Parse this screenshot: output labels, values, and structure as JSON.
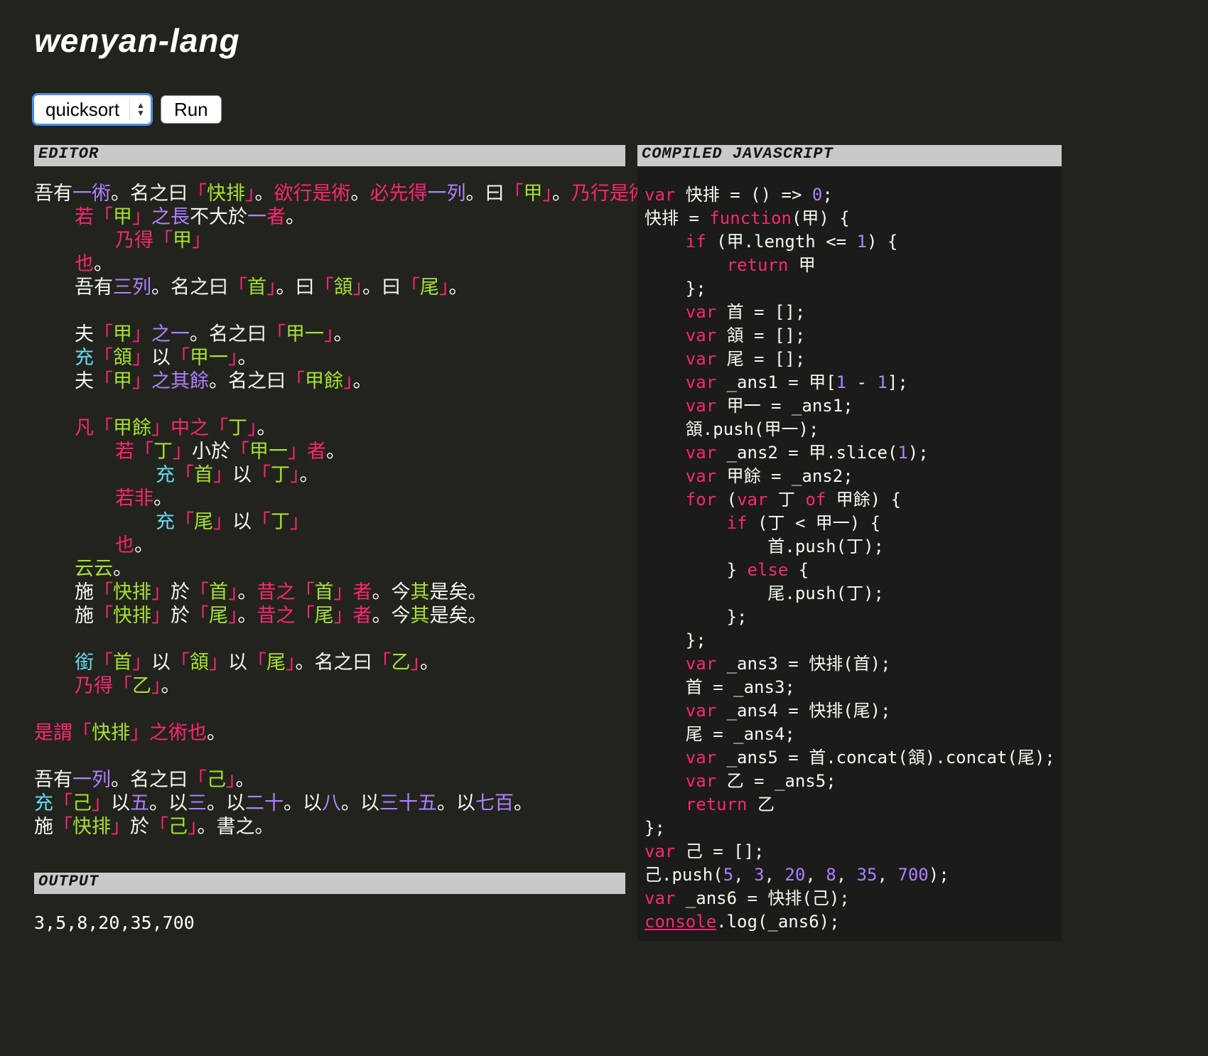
{
  "page": {
    "title": "wenyan-lang"
  },
  "toolbar": {
    "example_selected": "quicksort",
    "run_label": "Run"
  },
  "panels": {
    "editor_title": "EDITOR",
    "js_title": "COMPILED JAVASCRIPT",
    "output_title": "OUTPUT"
  },
  "output": {
    "text": "3,5,8,20,35,700"
  },
  "colors": {
    "page_bg": "#23231e",
    "js_panel_bg": "#1b1b19",
    "panel_header_bg": "#c9c9c9",
    "focus_ring": "#4a8fe2",
    "white": "#f8f8f2",
    "pink": "#f92672",
    "green": "#a6e22e",
    "purple": "#ae81ff",
    "cyan": "#66d9ef"
  },
  "editor_lines": [
    {
      "indent": 0,
      "tokens": [
        [
          "w",
          "吾有"
        ],
        [
          "b",
          "一術"
        ],
        [
          "w",
          "。"
        ],
        [
          "w",
          "名之曰"
        ],
        [
          "p",
          "「"
        ],
        [
          "g",
          "快排"
        ],
        [
          "p",
          "」"
        ],
        [
          "w",
          "。"
        ],
        [
          "p",
          "欲行是術"
        ],
        [
          "w",
          "。"
        ],
        [
          "p",
          "必先得"
        ],
        [
          "b",
          "一列"
        ],
        [
          "w",
          "。曰"
        ],
        [
          "p",
          "「"
        ],
        [
          "g",
          "甲"
        ],
        [
          "p",
          "」"
        ],
        [
          "w",
          "。"
        ],
        [
          "p",
          "乃行是術曰"
        ],
        [
          "w",
          "。"
        ]
      ]
    },
    {
      "indent": 1,
      "tokens": [
        [
          "p",
          "若"
        ],
        [
          "p",
          "「"
        ],
        [
          "g",
          "甲"
        ],
        [
          "p",
          "」"
        ],
        [
          "b",
          "之長"
        ],
        [
          "w",
          "不大於"
        ],
        [
          "b",
          "一"
        ],
        [
          "p",
          "者"
        ],
        [
          "w",
          "。"
        ]
      ]
    },
    {
      "indent": 2,
      "tokens": [
        [
          "p",
          "乃得"
        ],
        [
          "p",
          "「"
        ],
        [
          "g",
          "甲"
        ],
        [
          "p",
          "」"
        ]
      ]
    },
    {
      "indent": 1,
      "tokens": [
        [
          "p",
          "也"
        ],
        [
          "w",
          "。"
        ]
      ]
    },
    {
      "indent": 1,
      "tokens": [
        [
          "w",
          "吾有"
        ],
        [
          "b",
          "三列"
        ],
        [
          "w",
          "。名之曰"
        ],
        [
          "p",
          "「"
        ],
        [
          "g",
          "首"
        ],
        [
          "p",
          "」"
        ],
        [
          "w",
          "。曰"
        ],
        [
          "p",
          "「"
        ],
        [
          "g",
          "頷"
        ],
        [
          "p",
          "」"
        ],
        [
          "w",
          "。曰"
        ],
        [
          "p",
          "「"
        ],
        [
          "g",
          "尾"
        ],
        [
          "p",
          "」"
        ],
        [
          "w",
          "。"
        ]
      ]
    },
    {
      "indent": 0,
      "tokens": []
    },
    {
      "indent": 1,
      "tokens": [
        [
          "w",
          "夫"
        ],
        [
          "p",
          "「"
        ],
        [
          "g",
          "甲"
        ],
        [
          "p",
          "」"
        ],
        [
          "b",
          "之一"
        ],
        [
          "w",
          "。名之曰"
        ],
        [
          "p",
          "「"
        ],
        [
          "g",
          "甲一"
        ],
        [
          "p",
          "」"
        ],
        [
          "w",
          "。"
        ]
      ]
    },
    {
      "indent": 1,
      "tokens": [
        [
          "c",
          "充"
        ],
        [
          "p",
          "「"
        ],
        [
          "g",
          "頷"
        ],
        [
          "p",
          "」"
        ],
        [
          "w",
          "以"
        ],
        [
          "p",
          "「"
        ],
        [
          "g",
          "甲一"
        ],
        [
          "p",
          "」"
        ],
        [
          "w",
          "。"
        ]
      ]
    },
    {
      "indent": 1,
      "tokens": [
        [
          "w",
          "夫"
        ],
        [
          "p",
          "「"
        ],
        [
          "g",
          "甲"
        ],
        [
          "p",
          "」"
        ],
        [
          "b",
          "之其餘"
        ],
        [
          "w",
          "。名之曰"
        ],
        [
          "p",
          "「"
        ],
        [
          "g",
          "甲餘"
        ],
        [
          "p",
          "」"
        ],
        [
          "w",
          "。"
        ]
      ]
    },
    {
      "indent": 0,
      "tokens": []
    },
    {
      "indent": 1,
      "tokens": [
        [
          "p",
          "凡"
        ],
        [
          "p",
          "「"
        ],
        [
          "g",
          "甲餘"
        ],
        [
          "p",
          "」"
        ],
        [
          "p",
          "中之"
        ],
        [
          "p",
          "「"
        ],
        [
          "g",
          "丁"
        ],
        [
          "p",
          "」"
        ],
        [
          "w",
          "。"
        ]
      ]
    },
    {
      "indent": 2,
      "tokens": [
        [
          "p",
          "若"
        ],
        [
          "p",
          "「"
        ],
        [
          "g",
          "丁"
        ],
        [
          "p",
          "」"
        ],
        [
          "w",
          "小於"
        ],
        [
          "p",
          "「"
        ],
        [
          "g",
          "甲一"
        ],
        [
          "p",
          "」"
        ],
        [
          "p",
          "者"
        ],
        [
          "w",
          "。"
        ]
      ]
    },
    {
      "indent": 3,
      "tokens": [
        [
          "c",
          "充"
        ],
        [
          "p",
          "「"
        ],
        [
          "g",
          "首"
        ],
        [
          "p",
          "」"
        ],
        [
          "w",
          "以"
        ],
        [
          "p",
          "「"
        ],
        [
          "g",
          "丁"
        ],
        [
          "p",
          "」"
        ],
        [
          "w",
          "。"
        ]
      ]
    },
    {
      "indent": 2,
      "tokens": [
        [
          "p",
          "若非"
        ],
        [
          "w",
          "。"
        ]
      ]
    },
    {
      "indent": 3,
      "tokens": [
        [
          "c",
          "充"
        ],
        [
          "p",
          "「"
        ],
        [
          "g",
          "尾"
        ],
        [
          "p",
          "」"
        ],
        [
          "w",
          "以"
        ],
        [
          "p",
          "「"
        ],
        [
          "g",
          "丁"
        ],
        [
          "p",
          "」"
        ]
      ]
    },
    {
      "indent": 2,
      "tokens": [
        [
          "p",
          "也"
        ],
        [
          "w",
          "。"
        ]
      ]
    },
    {
      "indent": 1,
      "tokens": [
        [
          "g",
          "云云"
        ],
        [
          "w",
          "。"
        ]
      ]
    },
    {
      "indent": 1,
      "tokens": [
        [
          "w",
          "施"
        ],
        [
          "p",
          "「"
        ],
        [
          "g",
          "快排"
        ],
        [
          "p",
          "」"
        ],
        [
          "w",
          "於"
        ],
        [
          "p",
          "「"
        ],
        [
          "g",
          "首"
        ],
        [
          "p",
          "」"
        ],
        [
          "w",
          "。"
        ],
        [
          "p",
          "昔之"
        ],
        [
          "p",
          "「"
        ],
        [
          "g",
          "首"
        ],
        [
          "p",
          "」"
        ],
        [
          "p",
          "者"
        ],
        [
          "w",
          "。今"
        ],
        [
          "g",
          "其"
        ],
        [
          "w",
          "是矣。"
        ]
      ]
    },
    {
      "indent": 1,
      "tokens": [
        [
          "w",
          "施"
        ],
        [
          "p",
          "「"
        ],
        [
          "g",
          "快排"
        ],
        [
          "p",
          "」"
        ],
        [
          "w",
          "於"
        ],
        [
          "p",
          "「"
        ],
        [
          "g",
          "尾"
        ],
        [
          "p",
          "」"
        ],
        [
          "w",
          "。"
        ],
        [
          "p",
          "昔之"
        ],
        [
          "p",
          "「"
        ],
        [
          "g",
          "尾"
        ],
        [
          "p",
          "」"
        ],
        [
          "p",
          "者"
        ],
        [
          "w",
          "。今"
        ],
        [
          "g",
          "其"
        ],
        [
          "w",
          "是矣。"
        ]
      ]
    },
    {
      "indent": 0,
      "tokens": []
    },
    {
      "indent": 1,
      "tokens": [
        [
          "c",
          "銜"
        ],
        [
          "p",
          "「"
        ],
        [
          "g",
          "首"
        ],
        [
          "p",
          "」"
        ],
        [
          "w",
          "以"
        ],
        [
          "p",
          "「"
        ],
        [
          "g",
          "頷"
        ],
        [
          "p",
          "」"
        ],
        [
          "w",
          "以"
        ],
        [
          "p",
          "「"
        ],
        [
          "g",
          "尾"
        ],
        [
          "p",
          "」"
        ],
        [
          "w",
          "。名之曰"
        ],
        [
          "p",
          "「"
        ],
        [
          "g",
          "乙"
        ],
        [
          "p",
          "」"
        ],
        [
          "w",
          "。"
        ]
      ]
    },
    {
      "indent": 1,
      "tokens": [
        [
          "p",
          "乃得"
        ],
        [
          "p",
          "「"
        ],
        [
          "g",
          "乙"
        ],
        [
          "p",
          "」"
        ],
        [
          "w",
          "。"
        ]
      ]
    },
    {
      "indent": 0,
      "tokens": []
    },
    {
      "indent": 0,
      "tokens": [
        [
          "p",
          "是謂"
        ],
        [
          "p",
          "「"
        ],
        [
          "g",
          "快排"
        ],
        [
          "p",
          "」"
        ],
        [
          "p",
          "之術也"
        ],
        [
          "w",
          "。"
        ]
      ]
    },
    {
      "indent": 0,
      "tokens": []
    },
    {
      "indent": 0,
      "tokens": [
        [
          "w",
          "吾有"
        ],
        [
          "b",
          "一列"
        ],
        [
          "w",
          "。名之曰"
        ],
        [
          "p",
          "「"
        ],
        [
          "g",
          "己"
        ],
        [
          "p",
          "」"
        ],
        [
          "w",
          "。"
        ]
      ]
    },
    {
      "indent": 0,
      "tokens": [
        [
          "c",
          "充"
        ],
        [
          "p",
          "「"
        ],
        [
          "g",
          "己"
        ],
        [
          "p",
          "」"
        ],
        [
          "w",
          "以"
        ],
        [
          "b",
          "五"
        ],
        [
          "w",
          "。以"
        ],
        [
          "b",
          "三"
        ],
        [
          "w",
          "。以"
        ],
        [
          "b",
          "二十"
        ],
        [
          "w",
          "。以"
        ],
        [
          "b",
          "八"
        ],
        [
          "w",
          "。以"
        ],
        [
          "b",
          "三十五"
        ],
        [
          "w",
          "。以"
        ],
        [
          "b",
          "七百"
        ],
        [
          "w",
          "。"
        ]
      ]
    },
    {
      "indent": 0,
      "tokens": [
        [
          "w",
          "施"
        ],
        [
          "p",
          "「"
        ],
        [
          "g",
          "快排"
        ],
        [
          "p",
          "」"
        ],
        [
          "w",
          "於"
        ],
        [
          "p",
          "「"
        ],
        [
          "g",
          "己"
        ],
        [
          "p",
          "」"
        ],
        [
          "w",
          "。書之。"
        ]
      ]
    }
  ],
  "js_lines": [
    [
      [
        "p",
        "var"
      ],
      [
        "w",
        " 快排 = () => "
      ],
      [
        "b",
        "0"
      ],
      [
        "w",
        ";"
      ]
    ],
    [
      [
        "w",
        "快排 = "
      ],
      [
        "p",
        "function"
      ],
      [
        "w",
        "(甲) {"
      ]
    ],
    [
      [
        "w",
        "    "
      ],
      [
        "p",
        "if"
      ],
      [
        "w",
        " (甲.length <= "
      ],
      [
        "b",
        "1"
      ],
      [
        "w",
        ") {"
      ]
    ],
    [
      [
        "w",
        "        "
      ],
      [
        "p",
        "return"
      ],
      [
        "w",
        " 甲"
      ]
    ],
    [
      [
        "w",
        "    };"
      ]
    ],
    [
      [
        "w",
        "    "
      ],
      [
        "p",
        "var"
      ],
      [
        "w",
        " 首 = [];"
      ]
    ],
    [
      [
        "w",
        "    "
      ],
      [
        "p",
        "var"
      ],
      [
        "w",
        " 頷 = [];"
      ]
    ],
    [
      [
        "w",
        "    "
      ],
      [
        "p",
        "var"
      ],
      [
        "w",
        " 尾 = [];"
      ]
    ],
    [
      [
        "w",
        "    "
      ],
      [
        "p",
        "var"
      ],
      [
        "w",
        " _ans1 = 甲["
      ],
      [
        "b",
        "1"
      ],
      [
        "w",
        " - "
      ],
      [
        "b",
        "1"
      ],
      [
        "w",
        "];"
      ]
    ],
    [
      [
        "w",
        "    "
      ],
      [
        "p",
        "var"
      ],
      [
        "w",
        " 甲一 = _ans1;"
      ]
    ],
    [
      [
        "w",
        "    頷.push(甲一);"
      ]
    ],
    [
      [
        "w",
        "    "
      ],
      [
        "p",
        "var"
      ],
      [
        "w",
        " _ans2 = 甲.slice("
      ],
      [
        "b",
        "1"
      ],
      [
        "w",
        ");"
      ]
    ],
    [
      [
        "w",
        "    "
      ],
      [
        "p",
        "var"
      ],
      [
        "w",
        " 甲餘 = _ans2;"
      ]
    ],
    [
      [
        "w",
        "    "
      ],
      [
        "p",
        "for"
      ],
      [
        "w",
        " ("
      ],
      [
        "p",
        "var"
      ],
      [
        "w",
        " 丁 "
      ],
      [
        "p",
        "of"
      ],
      [
        "w",
        " 甲餘) {"
      ]
    ],
    [
      [
        "w",
        "        "
      ],
      [
        "p",
        "if"
      ],
      [
        "w",
        " (丁 < 甲一) {"
      ]
    ],
    [
      [
        "w",
        "            首.push(丁);"
      ]
    ],
    [
      [
        "w",
        "        } "
      ],
      [
        "p",
        "else"
      ],
      [
        "w",
        " {"
      ]
    ],
    [
      [
        "w",
        "            尾.push(丁);"
      ]
    ],
    [
      [
        "w",
        "        };"
      ]
    ],
    [
      [
        "w",
        "    };"
      ]
    ],
    [
      [
        "w",
        "    "
      ],
      [
        "p",
        "var"
      ],
      [
        "w",
        " _ans3 = 快排(首);"
      ]
    ],
    [
      [
        "w",
        "    首 = _ans3;"
      ]
    ],
    [
      [
        "w",
        "    "
      ],
      [
        "p",
        "var"
      ],
      [
        "w",
        " _ans4 = 快排(尾);"
      ]
    ],
    [
      [
        "w",
        "    尾 = _ans4;"
      ]
    ],
    [
      [
        "w",
        "    "
      ],
      [
        "p",
        "var"
      ],
      [
        "w",
        " _ans5 = 首.concat(頷).concat(尾);"
      ]
    ],
    [
      [
        "w",
        "    "
      ],
      [
        "p",
        "var"
      ],
      [
        "w",
        " 乙 = _ans5;"
      ]
    ],
    [
      [
        "w",
        "    "
      ],
      [
        "p",
        "return"
      ],
      [
        "w",
        " 乙"
      ]
    ],
    [
      [
        "w",
        "};"
      ]
    ],
    [
      [
        "p",
        "var"
      ],
      [
        "w",
        " 己 = [];"
      ]
    ],
    [
      [
        "w",
        "己.push("
      ],
      [
        "b",
        "5"
      ],
      [
        "w",
        ", "
      ],
      [
        "b",
        "3"
      ],
      [
        "w",
        ", "
      ],
      [
        "b",
        "20"
      ],
      [
        "w",
        ", "
      ],
      [
        "b",
        "8"
      ],
      [
        "w",
        ", "
      ],
      [
        "b",
        "35"
      ],
      [
        "w",
        ", "
      ],
      [
        "b",
        "700"
      ],
      [
        "w",
        ");"
      ]
    ],
    [
      [
        "p",
        "var"
      ],
      [
        "w",
        " _ans6 = 快排(己);"
      ]
    ],
    [
      [
        "u",
        "console"
      ],
      [
        "w",
        ".log(_ans6);"
      ]
    ]
  ]
}
